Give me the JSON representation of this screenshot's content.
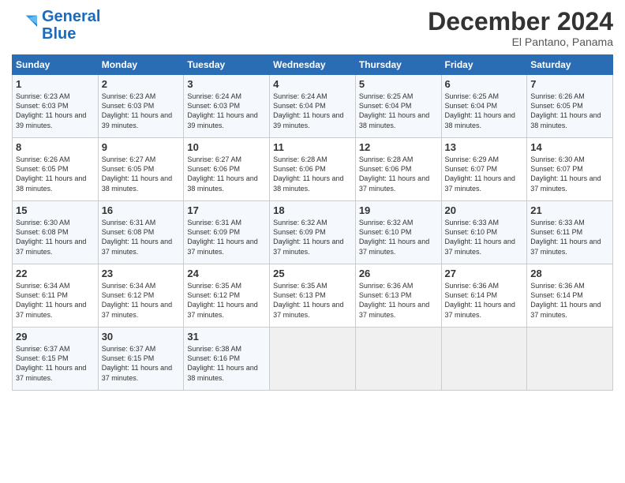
{
  "header": {
    "logo_line1": "General",
    "logo_line2": "Blue",
    "month": "December 2024",
    "location": "El Pantano, Panama"
  },
  "days_of_week": [
    "Sunday",
    "Monday",
    "Tuesday",
    "Wednesday",
    "Thursday",
    "Friday",
    "Saturday"
  ],
  "weeks": [
    [
      {
        "day": "1",
        "sunrise": "Sunrise: 6:23 AM",
        "sunset": "Sunset: 6:03 PM",
        "daylight": "Daylight: 11 hours and 39 minutes."
      },
      {
        "day": "2",
        "sunrise": "Sunrise: 6:23 AM",
        "sunset": "Sunset: 6:03 PM",
        "daylight": "Daylight: 11 hours and 39 minutes."
      },
      {
        "day": "3",
        "sunrise": "Sunrise: 6:24 AM",
        "sunset": "Sunset: 6:03 PM",
        "daylight": "Daylight: 11 hours and 39 minutes."
      },
      {
        "day": "4",
        "sunrise": "Sunrise: 6:24 AM",
        "sunset": "Sunset: 6:04 PM",
        "daylight": "Daylight: 11 hours and 39 minutes."
      },
      {
        "day": "5",
        "sunrise": "Sunrise: 6:25 AM",
        "sunset": "Sunset: 6:04 PM",
        "daylight": "Daylight: 11 hours and 38 minutes."
      },
      {
        "day": "6",
        "sunrise": "Sunrise: 6:25 AM",
        "sunset": "Sunset: 6:04 PM",
        "daylight": "Daylight: 11 hours and 38 minutes."
      },
      {
        "day": "7",
        "sunrise": "Sunrise: 6:26 AM",
        "sunset": "Sunset: 6:05 PM",
        "daylight": "Daylight: 11 hours and 38 minutes."
      }
    ],
    [
      {
        "day": "8",
        "sunrise": "Sunrise: 6:26 AM",
        "sunset": "Sunset: 6:05 PM",
        "daylight": "Daylight: 11 hours and 38 minutes."
      },
      {
        "day": "9",
        "sunrise": "Sunrise: 6:27 AM",
        "sunset": "Sunset: 6:05 PM",
        "daylight": "Daylight: 11 hours and 38 minutes."
      },
      {
        "day": "10",
        "sunrise": "Sunrise: 6:27 AM",
        "sunset": "Sunset: 6:06 PM",
        "daylight": "Daylight: 11 hours and 38 minutes."
      },
      {
        "day": "11",
        "sunrise": "Sunrise: 6:28 AM",
        "sunset": "Sunset: 6:06 PM",
        "daylight": "Daylight: 11 hours and 38 minutes."
      },
      {
        "day": "12",
        "sunrise": "Sunrise: 6:28 AM",
        "sunset": "Sunset: 6:06 PM",
        "daylight": "Daylight: 11 hours and 37 minutes."
      },
      {
        "day": "13",
        "sunrise": "Sunrise: 6:29 AM",
        "sunset": "Sunset: 6:07 PM",
        "daylight": "Daylight: 11 hours and 37 minutes."
      },
      {
        "day": "14",
        "sunrise": "Sunrise: 6:30 AM",
        "sunset": "Sunset: 6:07 PM",
        "daylight": "Daylight: 11 hours and 37 minutes."
      }
    ],
    [
      {
        "day": "15",
        "sunrise": "Sunrise: 6:30 AM",
        "sunset": "Sunset: 6:08 PM",
        "daylight": "Daylight: 11 hours and 37 minutes."
      },
      {
        "day": "16",
        "sunrise": "Sunrise: 6:31 AM",
        "sunset": "Sunset: 6:08 PM",
        "daylight": "Daylight: 11 hours and 37 minutes."
      },
      {
        "day": "17",
        "sunrise": "Sunrise: 6:31 AM",
        "sunset": "Sunset: 6:09 PM",
        "daylight": "Daylight: 11 hours and 37 minutes."
      },
      {
        "day": "18",
        "sunrise": "Sunrise: 6:32 AM",
        "sunset": "Sunset: 6:09 PM",
        "daylight": "Daylight: 11 hours and 37 minutes."
      },
      {
        "day": "19",
        "sunrise": "Sunrise: 6:32 AM",
        "sunset": "Sunset: 6:10 PM",
        "daylight": "Daylight: 11 hours and 37 minutes."
      },
      {
        "day": "20",
        "sunrise": "Sunrise: 6:33 AM",
        "sunset": "Sunset: 6:10 PM",
        "daylight": "Daylight: 11 hours and 37 minutes."
      },
      {
        "day": "21",
        "sunrise": "Sunrise: 6:33 AM",
        "sunset": "Sunset: 6:11 PM",
        "daylight": "Daylight: 11 hours and 37 minutes."
      }
    ],
    [
      {
        "day": "22",
        "sunrise": "Sunrise: 6:34 AM",
        "sunset": "Sunset: 6:11 PM",
        "daylight": "Daylight: 11 hours and 37 minutes."
      },
      {
        "day": "23",
        "sunrise": "Sunrise: 6:34 AM",
        "sunset": "Sunset: 6:12 PM",
        "daylight": "Daylight: 11 hours and 37 minutes."
      },
      {
        "day": "24",
        "sunrise": "Sunrise: 6:35 AM",
        "sunset": "Sunset: 6:12 PM",
        "daylight": "Daylight: 11 hours and 37 minutes."
      },
      {
        "day": "25",
        "sunrise": "Sunrise: 6:35 AM",
        "sunset": "Sunset: 6:13 PM",
        "daylight": "Daylight: 11 hours and 37 minutes."
      },
      {
        "day": "26",
        "sunrise": "Sunrise: 6:36 AM",
        "sunset": "Sunset: 6:13 PM",
        "daylight": "Daylight: 11 hours and 37 minutes."
      },
      {
        "day": "27",
        "sunrise": "Sunrise: 6:36 AM",
        "sunset": "Sunset: 6:14 PM",
        "daylight": "Daylight: 11 hours and 37 minutes."
      },
      {
        "day": "28",
        "sunrise": "Sunrise: 6:36 AM",
        "sunset": "Sunset: 6:14 PM",
        "daylight": "Daylight: 11 hours and 37 minutes."
      }
    ],
    [
      {
        "day": "29",
        "sunrise": "Sunrise: 6:37 AM",
        "sunset": "Sunset: 6:15 PM",
        "daylight": "Daylight: 11 hours and 37 minutes."
      },
      {
        "day": "30",
        "sunrise": "Sunrise: 6:37 AM",
        "sunset": "Sunset: 6:15 PM",
        "daylight": "Daylight: 11 hours and 37 minutes."
      },
      {
        "day": "31",
        "sunrise": "Sunrise: 6:38 AM",
        "sunset": "Sunset: 6:16 PM",
        "daylight": "Daylight: 11 hours and 38 minutes."
      },
      null,
      null,
      null,
      null
    ]
  ]
}
